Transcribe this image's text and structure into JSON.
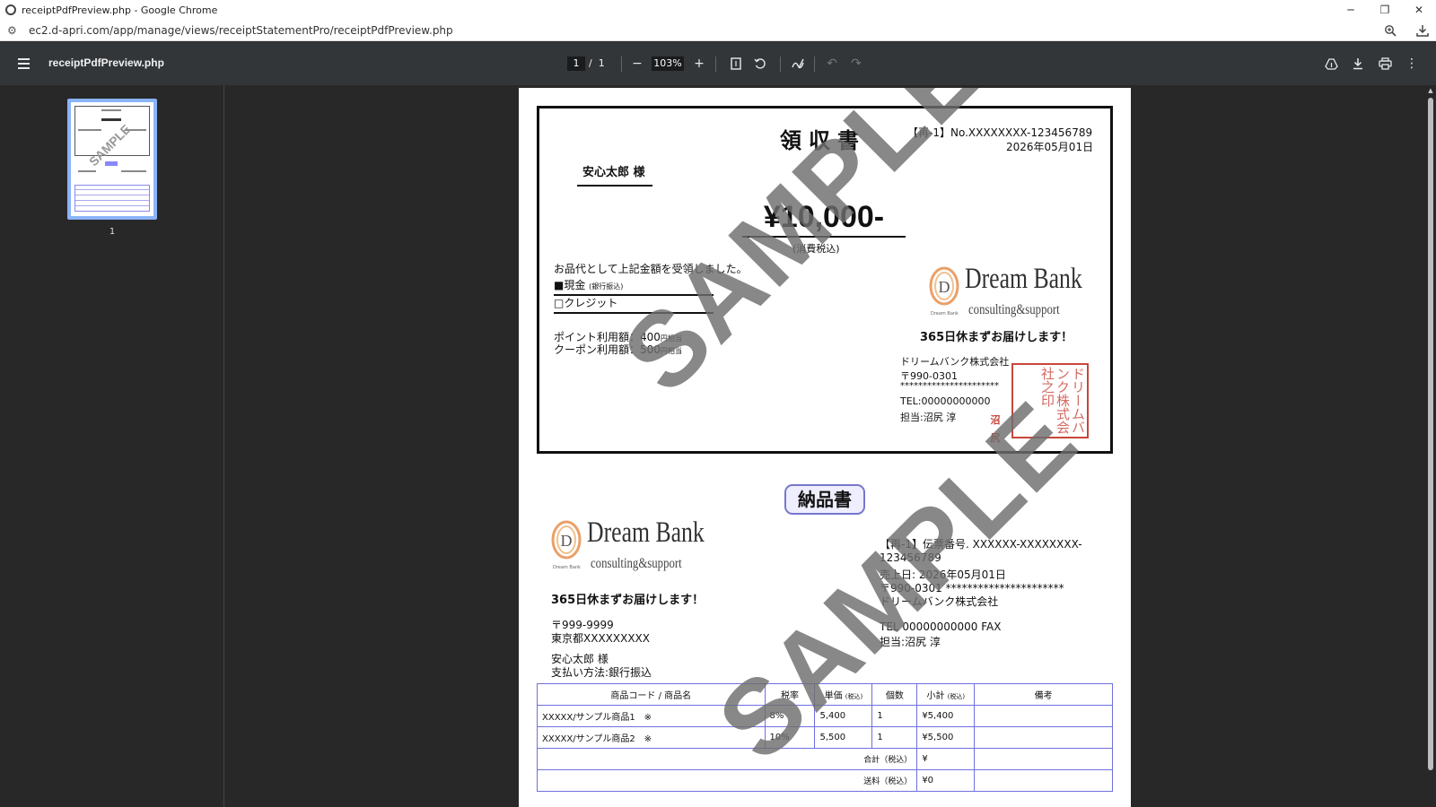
{
  "window": {
    "title": "receiptPdfPreview.php - Google Chrome",
    "url": "ec2.d-apri.com/app/manage/views/receiptStatementPro/receiptPdfPreview.php",
    "controls": {
      "minimize": "─",
      "restore": "❐",
      "close": "✕"
    }
  },
  "toolbar": {
    "filename": "receiptPdfPreview.php",
    "current_page": "1",
    "page_separator": "/",
    "total_pages": "1",
    "zoom": "103%",
    "zoom_out": "−",
    "zoom_in": "+",
    "icons": [
      "menu-icon",
      "fit-page-icon",
      "rotate-icon",
      "annotate-icon",
      "undo-icon",
      "redo-icon",
      "drive-icon",
      "download-icon",
      "print-icon",
      "more-icon"
    ]
  },
  "sidebar": {
    "thumbnail_label": "1"
  },
  "receipt": {
    "title": "領収書",
    "number": "【再-1】No.XXXXXXXX-123456789",
    "date": "2026年05月01日",
    "customer": "安心太郎 様",
    "amount": "¥10,000-",
    "tax_note": "(消費税込)",
    "received_text": "お品代として上記金額を受領しました。",
    "cash_label": "■現金",
    "cash_note": "(銀行振込)",
    "credit_label": "□クレジット",
    "points_label": "ポイント利用額：400",
    "points_suffix": "円相当",
    "coupon_label": "クーポン利用額：500",
    "coupon_suffix": "円相当",
    "logo_word": "Dream Bank",
    "logo_sub": "consulting&support",
    "logo_tiny": "Dream Bank",
    "slogan": "365日休まずお届けします！",
    "company": "ドリームバンク株式会社",
    "zip": "〒990-0301",
    "address": "**********************",
    "tel": "TEL:00000000000",
    "staff": "担当:沼尻 淳",
    "stamp_text": "ドリームバンク株式会社之印",
    "seal_text": "沼尻"
  },
  "watermark": "SAMPLE",
  "delivery": {
    "title": "納品書",
    "logo_word": "Dream Bank",
    "logo_sub": "consulting&support",
    "logo_tiny": "Dream Bank",
    "slogan": "365日休まずお届けします！",
    "customer_zip": "〒999-9999",
    "customer_address": "東京都XXXXXXXXX",
    "customer_name": "安心太郎 様",
    "payment": "支払い方法:銀行振込",
    "voucher": "【再-1】伝票番号. XXXXXX-XXXXXXXX-123456789",
    "sale_date": "売上日: 2026年05月01日",
    "zip_address": "〒990-0301 **********************",
    "company": "ドリームバンク株式会社",
    "tel_fax": "TEL 00000000000 FAX",
    "staff": "担当:沼尻 淳",
    "table": {
      "headers": {
        "item": "商品コード / 商品名",
        "rate": "税率",
        "unit_price": "単価",
        "unit_price_note": "(税込)",
        "qty": "個数",
        "subtotal": "小計",
        "subtotal_note": "(税込)",
        "remarks": "備考"
      },
      "rows": [
        {
          "item": "XXXXX/サンプル商品1　※",
          "rate": "8%",
          "unit_price": "5,400",
          "qty": "1",
          "subtotal": "¥5,400",
          "remarks": ""
        },
        {
          "item": "XXXXX/サンプル商品2　※",
          "rate": "10%",
          "unit_price": "5,500",
          "qty": "1",
          "subtotal": "¥5,500",
          "remarks": ""
        }
      ],
      "total_label": "合計（税込）",
      "total_value": "¥",
      "shipping_label": "送料（税込）",
      "shipping_value": "¥0"
    }
  },
  "colors": {
    "toolbar": "#323639",
    "viewer_bg": "#282828",
    "table_border": "#6f6fe0",
    "stamp": "#c8453c",
    "thumb_border": "#8ab4f8"
  }
}
